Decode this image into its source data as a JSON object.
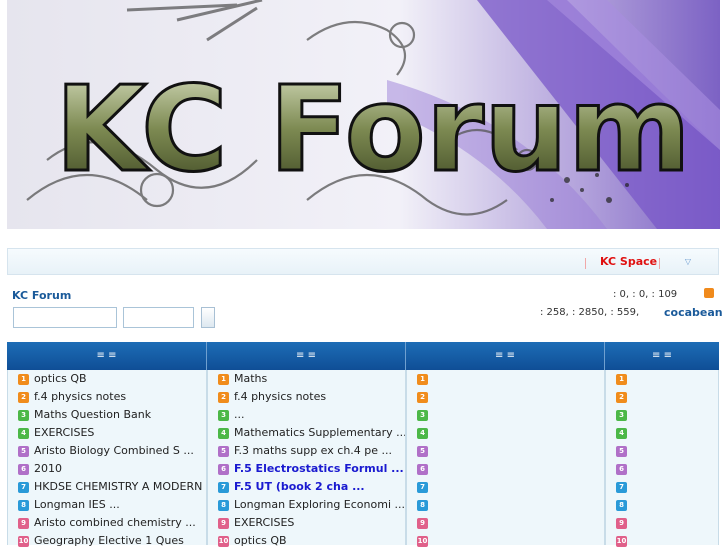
{
  "banner": {
    "title": "KC Forum"
  },
  "nav": {
    "space_label": "KC Space",
    "dropdown_icon": "chevron-down-icon"
  },
  "forum": {
    "title": "KC Forum",
    "stats_line1": ": 0,   : 0,   : 109",
    "stats_line2": ": 258,   : 2850,   : 559,",
    "newest_member": "cocabean"
  },
  "columns": [
    {
      "header": "≡      ≡"
    },
    {
      "header": "≡      ≡"
    },
    {
      "header": "≡      ≡"
    },
    {
      "header": "≡      ≡"
    }
  ],
  "rank_colors": [
    "#f08c1c",
    "#f08c1c",
    "#4cb848",
    "#4cb848",
    "#b070c8",
    "#b070c8",
    "#2a9ad8",
    "#2a9ad8",
    "#e0608a",
    "#e0608a"
  ],
  "col1": [
    {
      "text": "optics  QB"
    },
    {
      "text": "f.4 physics     notes"
    },
    {
      "text": "Maths Question Bank"
    },
    {
      "text": "     EXERCISES"
    },
    {
      "text": "Aristo Biology Combined S ..."
    },
    {
      "text": "2010"
    },
    {
      "text": "HKDSE CHEMISTRY A MODERN"
    },
    {
      "text": "Longman    IES      ..."
    },
    {
      "text": "Aristo combined chemistry ..."
    },
    {
      "text": "Geography Elective 1 Ques"
    }
  ],
  "col2": [
    {
      "text": "Maths"
    },
    {
      "text": "f.4 physics     notes"
    },
    {
      "text": "              ..."
    },
    {
      "text": "Mathematics Supplementary ..."
    },
    {
      "text": "F.3 maths supp ex ch.4 pe ..."
    },
    {
      "text": "F.5 Electrostatics Formul ...",
      "bold": true
    },
    {
      "text": "F.5 UT       (book 2 cha ...",
      "bold": true
    },
    {
      "text": "Longman Exploring Economi ..."
    },
    {
      "text": "     EXERCISES"
    },
    {
      "text": "optics  QB"
    }
  ]
}
